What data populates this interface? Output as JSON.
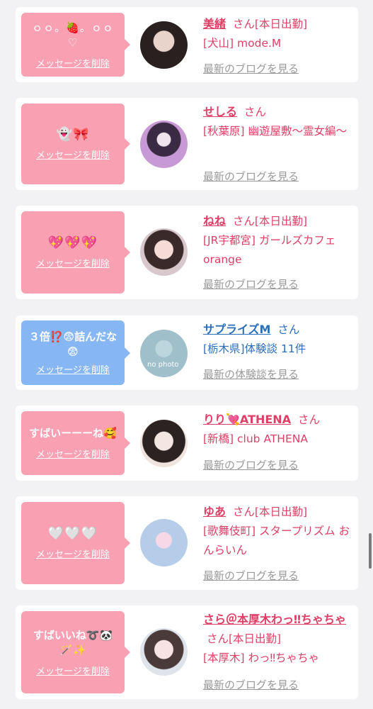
{
  "delete_label": "メッセージを削除",
  "blog_link": "最新のブログを見る",
  "review_link": "最新の体験談を見る",
  "honorific": "さん",
  "colors": {
    "pink_bubble": "#f9a0b2",
    "blue_bubble": "#86b7f4",
    "name_pink": "#dd3f66",
    "name_blue": "#2d6eb9"
  },
  "items": [
    {
      "message": "ｏｏ。🍓。ｏｏ♡",
      "name": "美緒",
      "status": "[本日出勤]",
      "shop_line": "[犬山] mode.M",
      "link_type": "blog"
    },
    {
      "message": "👻🎀",
      "name": "せしる",
      "status": "",
      "shop_line": "[秋葉原] 幽遊屋敷～霊女編～",
      "link_type": "blog"
    },
    {
      "message": "💖💖💖",
      "name": "ねね",
      "status": "[本日出勤]",
      "shop_line": "[JR宇都宮] ガールズカフェ orange",
      "link_type": "blog"
    },
    {
      "message": "３倍⁉️😨詰んだな😨",
      "name": "サプライズM",
      "status": "",
      "shop_line": "[栃木県]体験談 11件",
      "link_type": "review",
      "avatar_text": "no photo"
    },
    {
      "message": "すばいーーーね🥰",
      "name": "りり💘ATHENA",
      "status": "",
      "shop_line": "[新橋] club ATHENA",
      "link_type": "blog"
    },
    {
      "message": "🤍🤍🤍",
      "name": "ゆあ",
      "status": "[本日出勤]",
      "shop_line": "[歌舞伎町] スタープリズム おんらいん",
      "link_type": "blog"
    },
    {
      "message": "すばいいね➰🐼🪄✨",
      "name": "さら＠本厚木わっ‼ちゃちゃ",
      "status": "[本日出勤]",
      "shop_line": "[本厚木] わっ‼ちゃちゃ",
      "link_type": "blog"
    }
  ]
}
